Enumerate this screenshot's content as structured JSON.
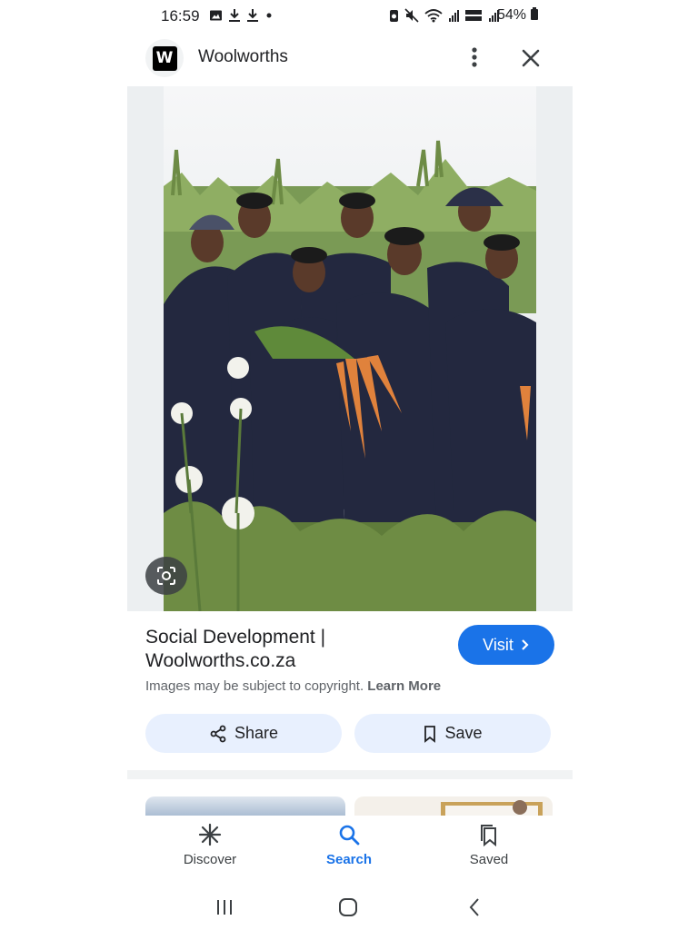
{
  "status_bar": {
    "time": "16:59",
    "battery": "54%",
    "left_icons": [
      "image-icon",
      "download-icon",
      "download-icon",
      "dot-icon"
    ],
    "right_icons": [
      "battery-saver-icon",
      "mute-icon",
      "wifi-icon",
      "signal-icon",
      "volte-icon",
      "signal-icon",
      "battery-icon"
    ],
    "volte_label": "Vo)) LTE2"
  },
  "header": {
    "logo_letter": "W",
    "site_name": "Woolworths",
    "more_icon": "more-vert-icon",
    "close_icon": "close-icon"
  },
  "image": {
    "lens_icon": "google-lens-icon"
  },
  "result": {
    "title_line1": "Social Development |",
    "title_line2": "Woolworths.co.za",
    "visit_label": "Visit",
    "copyright_text": "Images may be subject to copyright.",
    "learn_more": "Learn More",
    "share_label": "Share",
    "save_label": "Save"
  },
  "bottom_nav": {
    "items": [
      {
        "label": "Discover",
        "icon": "asterisk-icon",
        "active": false
      },
      {
        "label": "Search",
        "icon": "search-icon",
        "active": true
      },
      {
        "label": "Saved",
        "icon": "bookmarks-icon",
        "active": false
      }
    ]
  },
  "system_nav": [
    "recents-icon",
    "home-icon",
    "back-icon"
  ],
  "colors": {
    "accent": "#1a73e8",
    "chip_bg": "#e8f0fe",
    "text": "#202124",
    "secondary_text": "#5f6368"
  }
}
